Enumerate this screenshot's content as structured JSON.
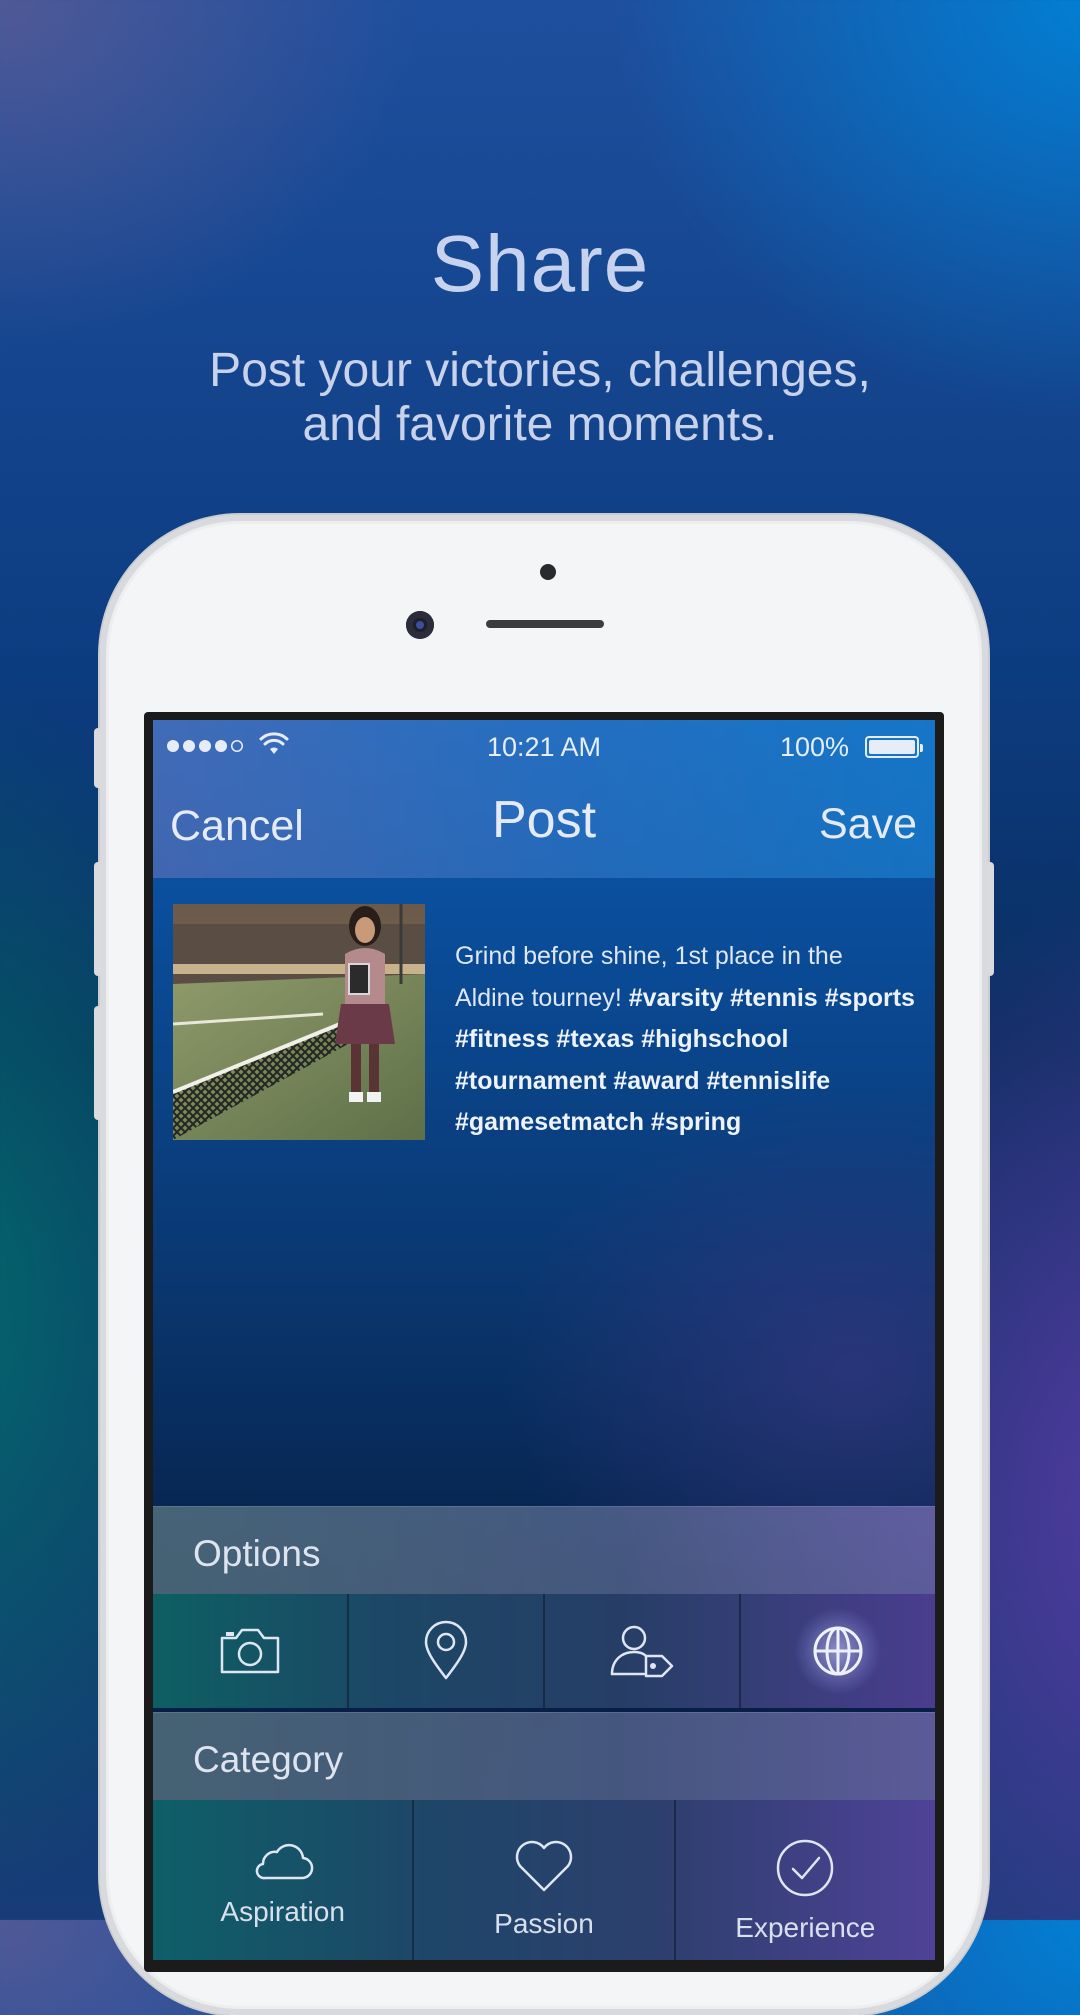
{
  "promo": {
    "title": "Share",
    "subtitle_line1": "Post your victories, challenges,",
    "subtitle_line2": "and favorite moments."
  },
  "status_bar": {
    "time": "10:21 AM",
    "battery": "100%",
    "signal_bars": 5,
    "signal_filled": 4
  },
  "nav": {
    "cancel": "Cancel",
    "title": "Post",
    "save": "Save"
  },
  "post": {
    "text_plain": "Grind before shine, 1st place in the Aldine tourney!",
    "hashtags": "#varsity #tennis #sports #fitness #texas #highschool #tournament #award #tennislife #gamesetmatch #spring"
  },
  "options": {
    "header": "Options",
    "buttons": [
      {
        "icon": "camera-icon"
      },
      {
        "icon": "location-pin-icon"
      },
      {
        "icon": "tag-person-icon"
      },
      {
        "icon": "globe-icon",
        "selected": true
      }
    ]
  },
  "category": {
    "header": "Category",
    "items": [
      {
        "icon": "cloud-icon",
        "label": "Aspiration"
      },
      {
        "icon": "heart-icon",
        "label": "Passion"
      },
      {
        "icon": "checkmark-circle-icon",
        "label": "Experience"
      }
    ]
  },
  "colors": {
    "text_light": "#e4eaf6",
    "accent_glow": "#c8d2ff"
  }
}
